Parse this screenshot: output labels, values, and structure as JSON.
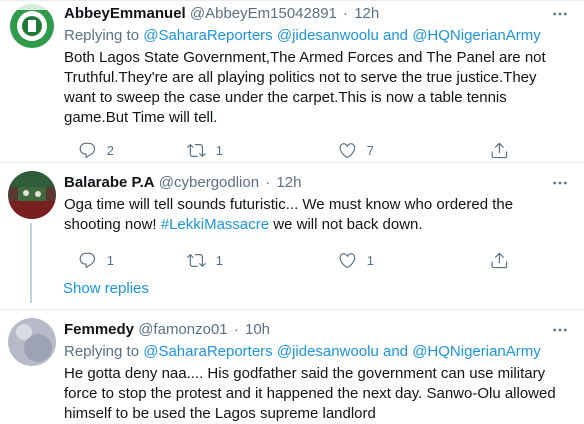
{
  "tweets": [
    {
      "name": "AbbeyEmmanuel",
      "handle": "@AbbeyEm15042891",
      "sep": "·",
      "time": "12h",
      "reply_prefix": "Replying to",
      "reply_targets": [
        "@SaharaReporters",
        "@jidesanwoolu",
        "and",
        "@HQNigerianArmy"
      ],
      "text": "Both Lagos State Government,The Armed Forces and The Panel are not Truthful.They're are all playing politics not to serve the true justice.They want to sweep the case under the carpet.This is now a table tennis game.But Time will tell.",
      "reply_count": "2",
      "retweet_count": "1",
      "like_count": "7"
    },
    {
      "name": "Balarabe P.A",
      "handle": "@cybergodlion",
      "sep": "·",
      "time": "12h",
      "text_before": "Oga time will tell sounds futuristic... We must know who ordered the shooting now! ",
      "hashtag": "#LekkiMassacre",
      "text_after": " we will not back down.",
      "reply_count": "1",
      "retweet_count": "1",
      "like_count": "1"
    },
    {
      "name": "Femmedy",
      "handle": "@famonzo01",
      "sep": "·",
      "time": "10h",
      "reply_prefix": "Replying to",
      "reply_targets": [
        "@SaharaReporters",
        "@jidesanwoolu",
        "and",
        "@HQNigerianArmy"
      ],
      "text": "He gotta deny naa.... His godfather said the government can use military force to stop the protest and it happened the next day. Sanwo-Olu allowed himself to be used the Lagos supreme landlord"
    }
  ],
  "show_replies": "Show replies",
  "colors": {
    "link": "#1b95e0",
    "secondary": "#5b7083",
    "primary_text": "#0f1419"
  },
  "icons": [
    "more-icon",
    "reply-icon",
    "retweet-icon",
    "like-icon"
  ]
}
